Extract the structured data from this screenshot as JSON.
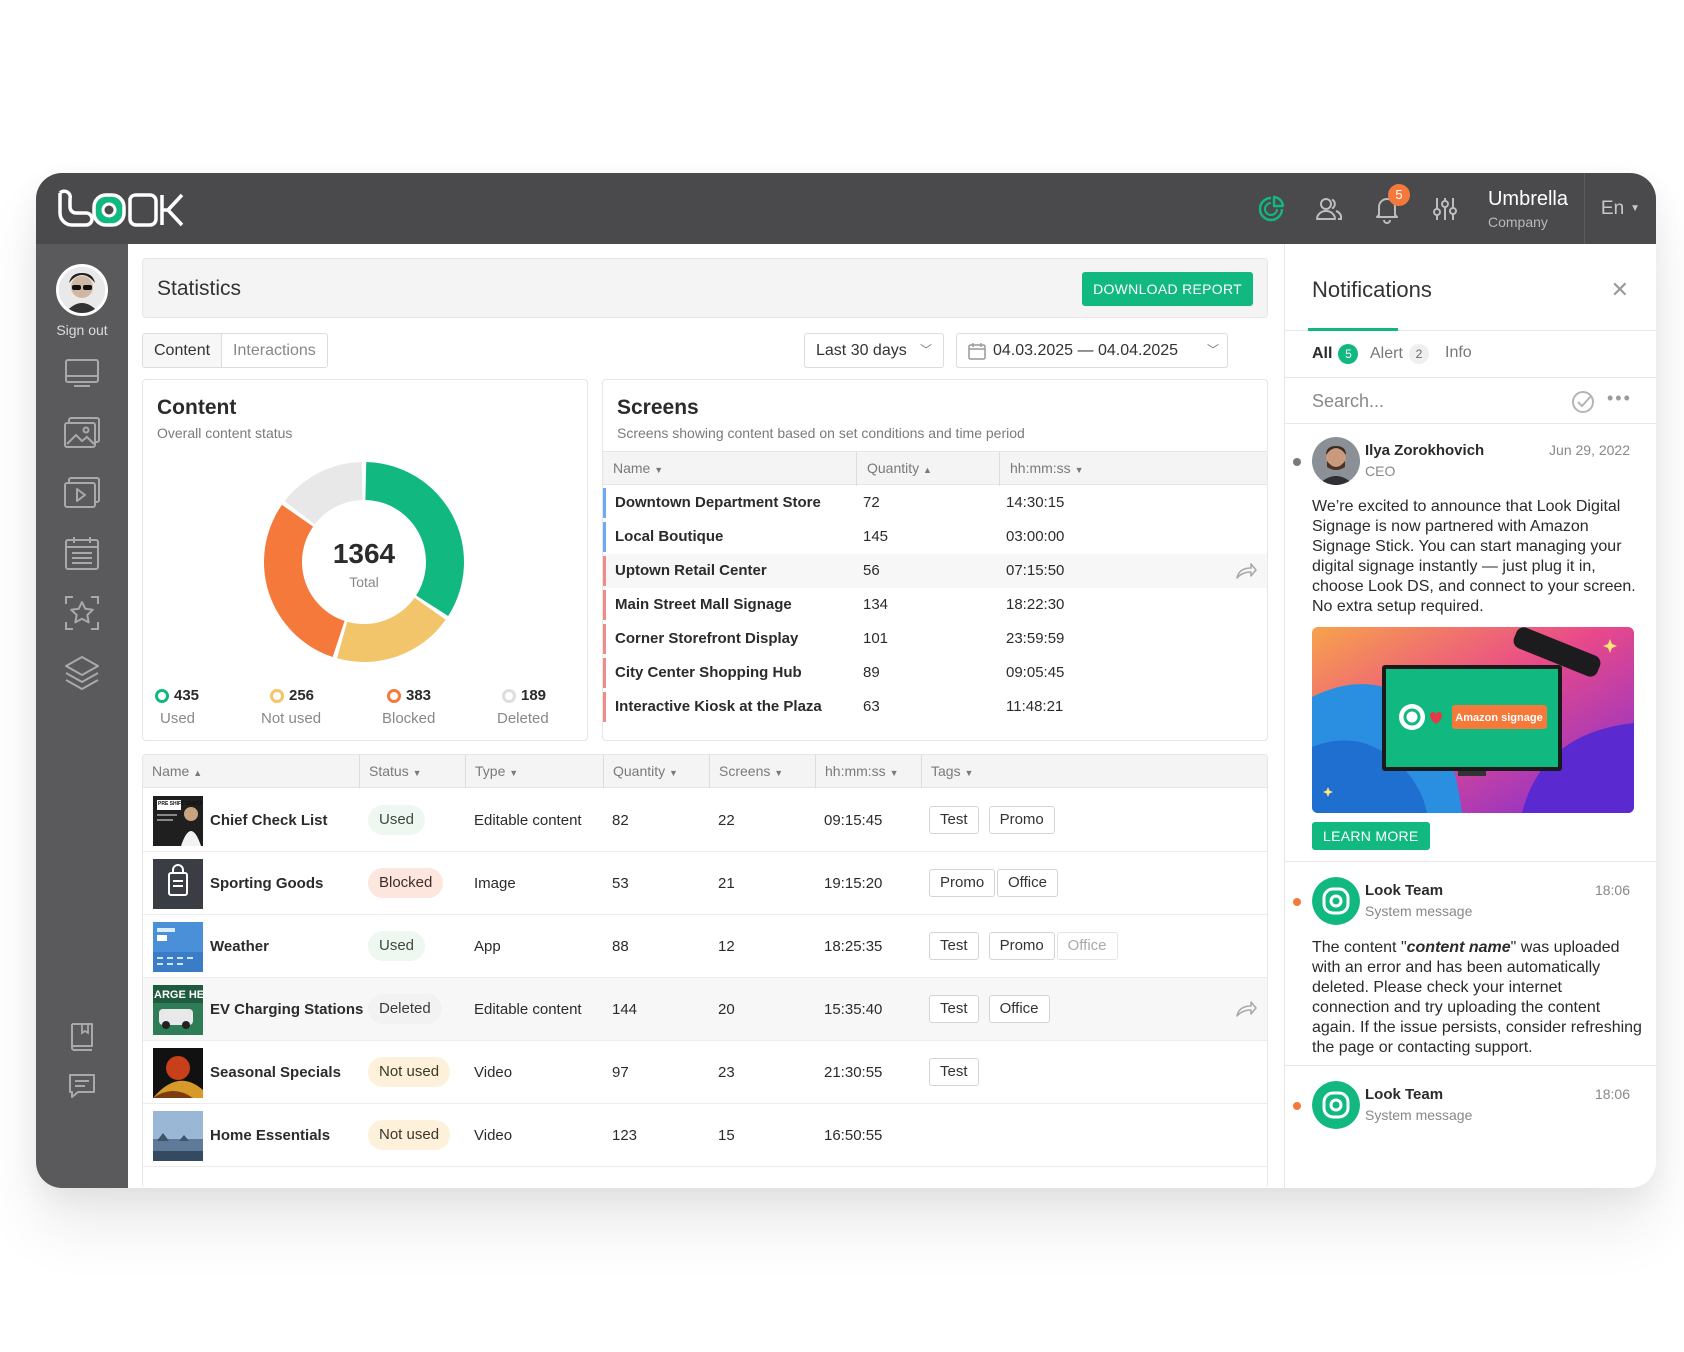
{
  "app": {
    "logo_text": "LOOK",
    "company_name": "Umbrella",
    "company_sub": "Company",
    "language": "En",
    "notification_badge": "5",
    "icons": [
      "statistics-icon",
      "users-icon",
      "bell-icon",
      "settings-sliders-icon"
    ]
  },
  "sidebar": {
    "sign_out": "Sign out",
    "items": [
      "screens-icon",
      "media-icon",
      "playlists-icon",
      "schedule-icon",
      "templates-icon",
      "layers-icon",
      "docs-icon",
      "chat-icon"
    ]
  },
  "header": {
    "title": "Statistics",
    "download_label": "DOWNLOAD REPORT"
  },
  "tabs": [
    {
      "label": "Content",
      "active": true
    },
    {
      "label": "Interactions",
      "active": false
    }
  ],
  "filters": {
    "period": "Last 30 days",
    "date_range": "04.03.2025 — 04.04.2025"
  },
  "content_card": {
    "title": "Content",
    "subtitle": "Overall content status",
    "total_value": "1364",
    "total_label": "Total",
    "legend": [
      {
        "value": "435",
        "label": "Used",
        "color": "#11b981"
      },
      {
        "value": "256",
        "label": "Not used",
        "color": "#f2c56b"
      },
      {
        "value": "383",
        "label": "Blocked",
        "color": "#f5793a"
      },
      {
        "value": "189",
        "label": "Deleted",
        "color": "#e8e8e8"
      }
    ]
  },
  "chart_data": {
    "type": "pie",
    "categories": [
      "Used",
      "Not used",
      "Blocked",
      "Deleted"
    ],
    "values": [
      435,
      256,
      383,
      189
    ],
    "colors": [
      "#11b981",
      "#f2c56b",
      "#f5793a",
      "#e8e8e8"
    ],
    "title": "",
    "center_value": 1364,
    "center_label": "Total"
  },
  "screens_card": {
    "title": "Screens",
    "subtitle": "Screens showing content based on set conditions and time period",
    "columns": [
      "Name",
      "Quantity",
      "hh:mm:ss"
    ],
    "rows": [
      {
        "name": "Downtown Department Store",
        "quantity": "72",
        "time": "14:30:15",
        "color": "#6fa8f2"
      },
      {
        "name": "Local Boutique",
        "quantity": "145",
        "time": "03:00:00",
        "color": "#6fa8f2"
      },
      {
        "name": "Uptown Retail Center",
        "quantity": "56",
        "time": "07:15:50",
        "color": "#f28a8a"
      },
      {
        "name": "Main Street Mall Signage",
        "quantity": "134",
        "time": "18:22:30",
        "color": "#f28a8a"
      },
      {
        "name": "Corner Storefront Display",
        "quantity": "101",
        "time": "23:59:59",
        "color": "#f28a8a"
      },
      {
        "name": "City Center Shopping Hub",
        "quantity": "89",
        "time": "09:05:45",
        "color": "#f28a8a"
      },
      {
        "name": "Interactive Kiosk at the Plaza",
        "quantity": "63",
        "time": "11:48:21",
        "color": "#f28a8a"
      }
    ]
  },
  "content_table": {
    "columns": [
      "Name",
      "Status",
      "Type",
      "Quantity",
      "Screens",
      "hh:mm:ss",
      "Tags"
    ],
    "rows": [
      {
        "name": "Chief Check List",
        "status": "Used",
        "status_kind": "used",
        "type": "Editable content",
        "quantity": "82",
        "screens": "22",
        "time": "09:15:45",
        "tags": [
          "Test",
          "Promo"
        ],
        "thumb_text": "PRE SHIFT CHECKLIST"
      },
      {
        "name": "Sporting Goods",
        "status": "Blocked",
        "status_kind": "blocked",
        "type": "Image",
        "quantity": "53",
        "screens": "21",
        "time": "19:15:20",
        "tags": [
          "Promo",
          "Office"
        ]
      },
      {
        "name": "Weather",
        "status": "Used",
        "status_kind": "used",
        "type": "App",
        "quantity": "88",
        "screens": "12",
        "time": "18:25:35",
        "tags": [
          "Test",
          "Promo",
          "Office"
        ]
      },
      {
        "name": "EV Charging Stations",
        "status": "Deleted",
        "status_kind": "deleted",
        "type": "Editable content",
        "quantity": "144",
        "screens": "20",
        "time": "15:35:40",
        "tags": [
          "Test",
          "Office"
        ],
        "thumb_text": "ARGE HE"
      },
      {
        "name": "Seasonal Specials",
        "status": "Not used",
        "status_kind": "notused",
        "type": "Video",
        "quantity": "97",
        "screens": "23",
        "time": "21:30:55",
        "tags": [
          "Test"
        ]
      },
      {
        "name": "Home Essentials",
        "status": "Not used",
        "status_kind": "notused",
        "type": "Video",
        "quantity": "123",
        "screens": "15",
        "time": "16:50:55",
        "tags": []
      }
    ]
  },
  "notifications": {
    "title": "Notifications",
    "tabs": [
      {
        "label": "All",
        "count": "5"
      },
      {
        "label": "Alert",
        "count": "2"
      },
      {
        "label": "Info",
        "count": ""
      }
    ],
    "search_placeholder": "Search...",
    "items": [
      {
        "name": "Ilya Zorokhovich",
        "role": "CEO",
        "date": "Jun 29, 2022",
        "body": "We’re excited to announce that Look Digital Signage is now partnered with Amazon Signage Stick. You can start managing your digital signage instantly — just plug it in, choose Look DS, and connect to your screen. No extra setup required.",
        "image_label": "Amazon signage",
        "button": "LEARN MORE"
      },
      {
        "name": "Look Team",
        "role": "System message",
        "date": "18:06",
        "body_prefix": "The content \"",
        "body_em": "content name",
        "body_suffix": "\" was uploaded with an error and has been automatically deleted. Please check your internet connection and try uploading the content again. If the issue persists, consider refreshing the page or contacting support."
      },
      {
        "name": "Look Team",
        "role": "System message",
        "date": "18:06"
      }
    ]
  }
}
